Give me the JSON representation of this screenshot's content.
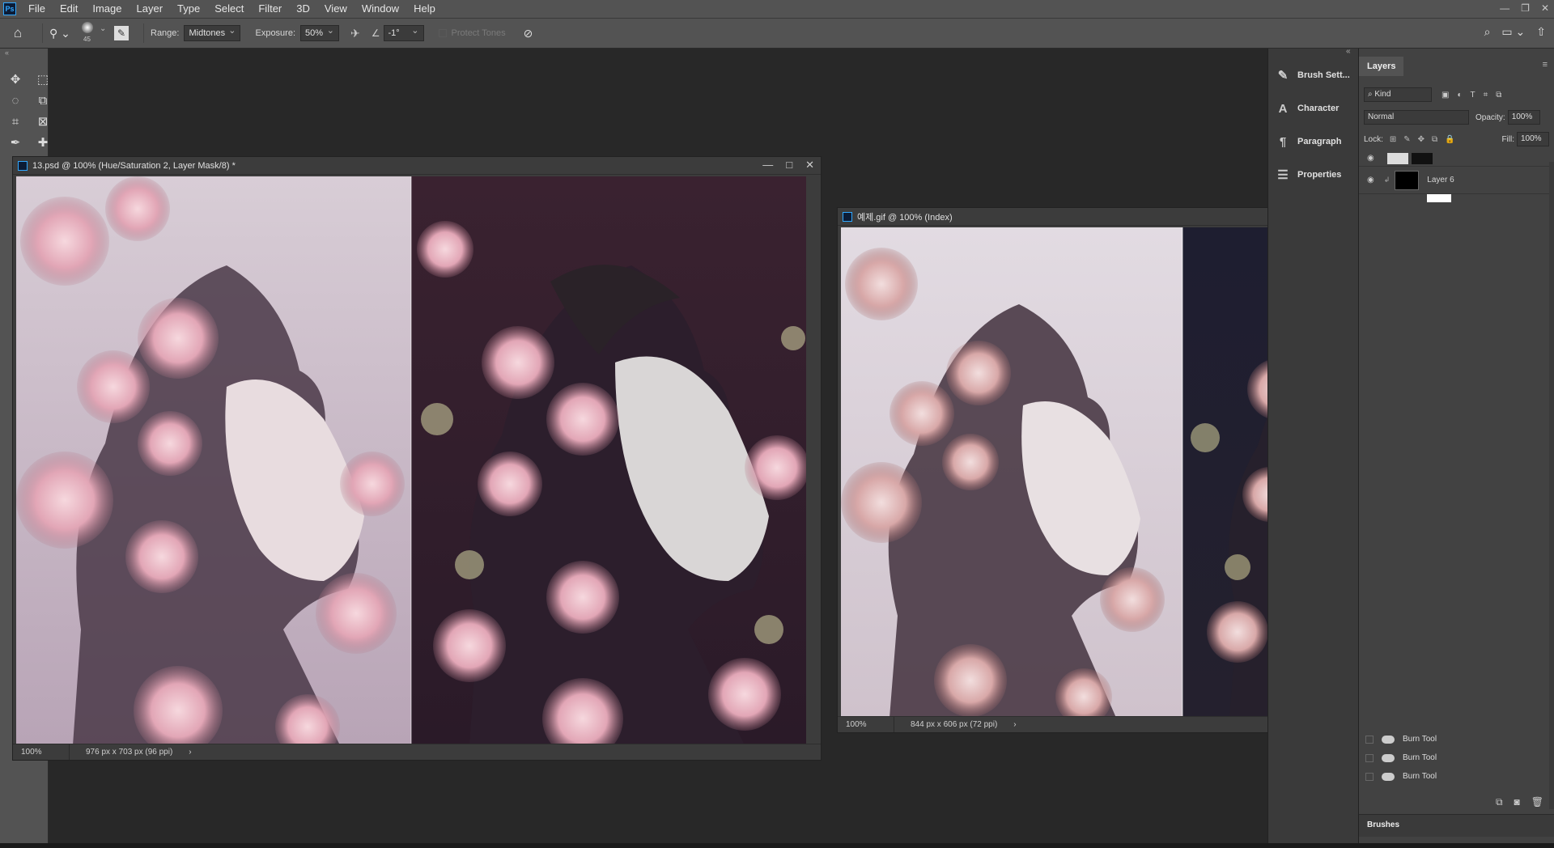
{
  "menubar": {
    "logo": "Ps",
    "items": [
      "File",
      "Edit",
      "Image",
      "Layer",
      "Type",
      "Select",
      "Filter",
      "3D",
      "View",
      "Window",
      "Help"
    ]
  },
  "options": {
    "brush_size": "45",
    "range_label": "Range:",
    "range_value": "Midtones",
    "exposure_label": "Exposure:",
    "exposure_value": "50%",
    "angle_value": "-1°",
    "protect_tones": "Protect Tones"
  },
  "doc1": {
    "title": "13.psd @ 100% (Hue/Saturation 2, Layer Mask/8) *",
    "zoom": "100%",
    "info": "976 px x 703 px (96 ppi)"
  },
  "doc2": {
    "title": "예제.gif @ 100% (Index)",
    "zoom": "100%",
    "info": "844 px x 606 px (72 ppi)"
  },
  "dock": {
    "items": [
      "Brush Sett...",
      "Character",
      "Paragraph",
      "Properties"
    ]
  },
  "layers": {
    "tab": "Layers",
    "kind": "Kind",
    "blend": "Normal",
    "opacity_label": "Opacity:",
    "opacity_value": "100%",
    "lock_label": "Lock:",
    "fill_label": "Fill:",
    "fill_value": "100%",
    "layer6": "Layer 6"
  },
  "history": {
    "items": [
      "Burn Tool",
      "Burn Tool",
      "Burn Tool"
    ]
  },
  "brushes_tab": "Brushes",
  "colors": {
    "ps_blue": "#31a8ff",
    "chrome": "#535353",
    "workspace": "#282828"
  }
}
